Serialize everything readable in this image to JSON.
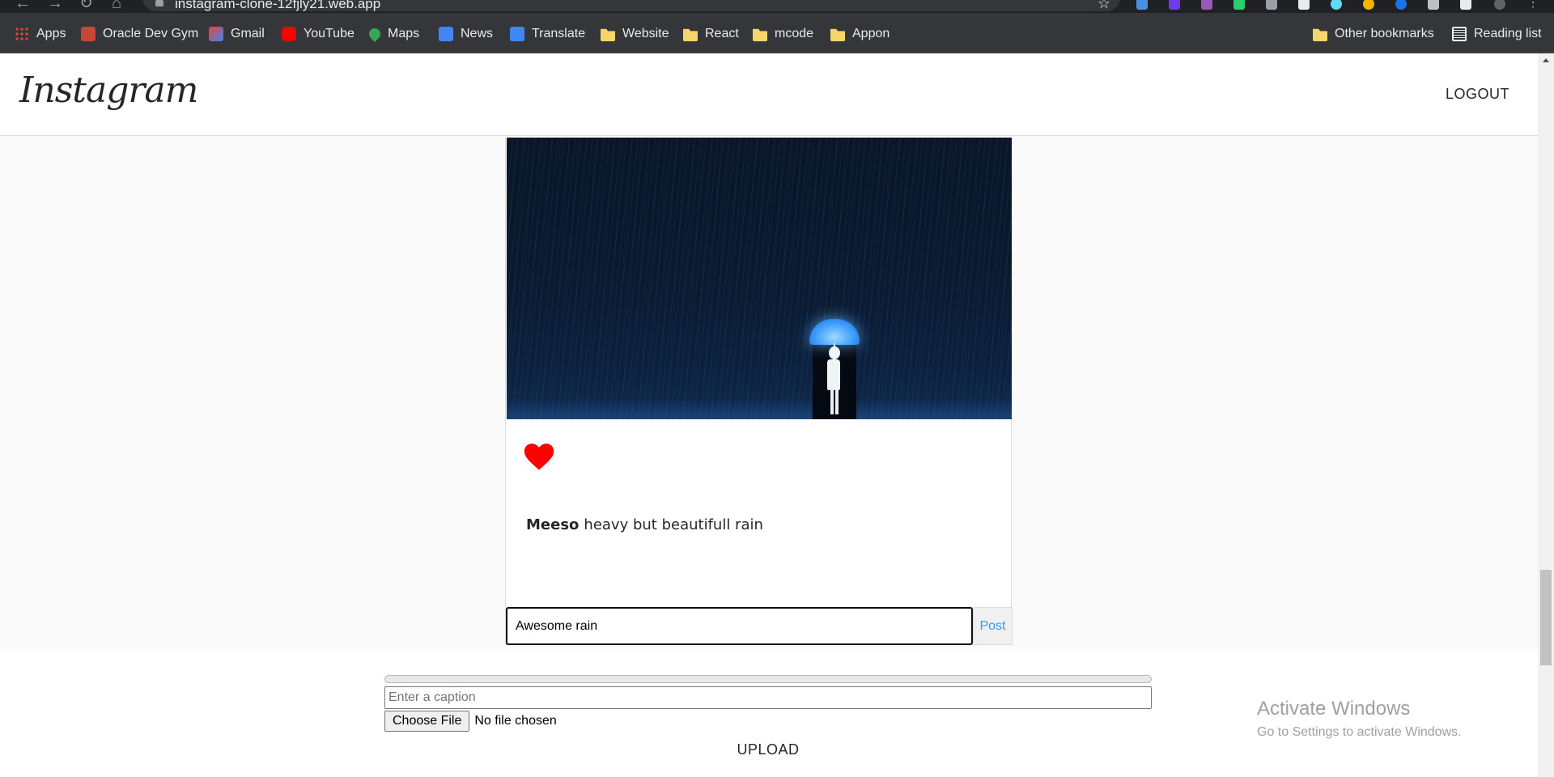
{
  "browser": {
    "url": "instagram-clone-12fjly21.web.app",
    "bookmarks": [
      {
        "label": "Apps",
        "icon": "apps-grid-icon"
      },
      {
        "label": "Oracle Dev Gym",
        "icon": "oracle-icon"
      },
      {
        "label": "Gmail",
        "icon": "gmail-icon"
      },
      {
        "label": "YouTube",
        "icon": "youtube-icon"
      },
      {
        "label": "Maps",
        "icon": "maps-icon"
      },
      {
        "label": "News",
        "icon": "news-icon"
      },
      {
        "label": "Translate",
        "icon": "translate-icon"
      },
      {
        "label": "Website",
        "icon": "folder-icon"
      },
      {
        "label": "React",
        "icon": "folder-icon"
      },
      {
        "label": "mcode",
        "icon": "folder-icon"
      },
      {
        "label": "Appon",
        "icon": "folder-icon"
      }
    ],
    "other_bookmarks": "Other bookmarks",
    "reading_list": "Reading list"
  },
  "header": {
    "logo": "Instagram",
    "logout_label": "LOGOUT"
  },
  "post": {
    "username": "Meeso",
    "caption": "heavy but beautifull rain",
    "liked": true,
    "comment_value": "Awesome rain",
    "post_button": "Post"
  },
  "upload": {
    "progress": 0,
    "caption_placeholder": "Enter a caption",
    "choose_file_label": "Choose File",
    "no_file_text": "No file chosen",
    "upload_label": "UPLOAD"
  },
  "watermark": {
    "title": "Activate Windows",
    "subtitle": "Go to Settings to activate Windows."
  },
  "colors": {
    "heart": "#ff0000",
    "post_link": "#3897f0",
    "bookmark_bar": "#35363a"
  }
}
